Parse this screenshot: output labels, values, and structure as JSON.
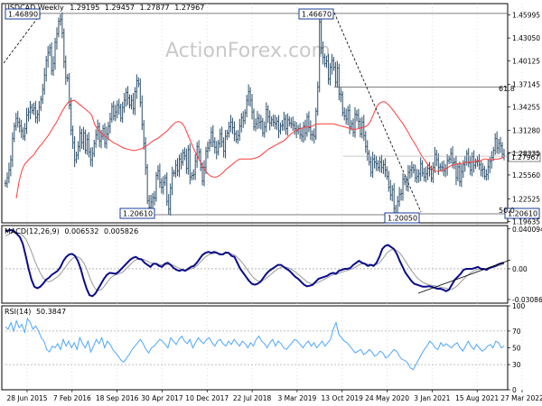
{
  "watermark": "ActionForex.com",
  "colors": {
    "price_bar": "#2a4e6c",
    "ema": "#ff3b3b",
    "macd": "#0b0b8a",
    "signal": "#9a9a9a",
    "rsi": "#4da6ff",
    "grid": "#c8c8c8",
    "frame": "#000000",
    "box": "#1a3c9c"
  },
  "chart_data": [
    {
      "type": "candlestick",
      "title": "USDCAD,Weekly",
      "ohlc_header": [
        "1.29195",
        "1.29457",
        "1.27877",
        "1.27967"
      ],
      "y_ticks": [
        "1.45995",
        "1.43050",
        "1.40125",
        "1.37145",
        "1.34255",
        "1.31280",
        "1.28335",
        "1.25560",
        "1.22525",
        "1.19635"
      ],
      "last_price": "1.27967",
      "ylim": [
        1.1945,
        1.4744
      ],
      "x_ticks": [
        "28 Jun 2015",
        "7 Feb 2016",
        "18 Sep 2016",
        "30 Apr 2017",
        "10 Dec 2017",
        "22 Jul 2018",
        "3 Mar 2019",
        "13 Oct 2019",
        "24 May 2020",
        "3 Jan 2021",
        "15 Aug 2021",
        "27 Mar 2022"
      ],
      "close_series": [
        1.245,
        1.252,
        1.262,
        1.275,
        1.302,
        1.318,
        1.328,
        1.323,
        1.318,
        1.312,
        1.305,
        1.315,
        1.332,
        1.336,
        1.342,
        1.338,
        1.341,
        1.329,
        1.333,
        1.342,
        1.352,
        1.365,
        1.383,
        1.402,
        1.412,
        1.418,
        1.389,
        1.398,
        1.425,
        1.436,
        1.452,
        1.454,
        1.437,
        1.4,
        1.38,
        1.379,
        1.345,
        1.313,
        1.297,
        1.275,
        1.281,
        1.292,
        1.309,
        1.297,
        1.309,
        1.287,
        1.301,
        1.285,
        1.275,
        1.283,
        1.296,
        1.307,
        1.317,
        1.299,
        1.305,
        1.315,
        1.296,
        1.308,
        1.318,
        1.327,
        1.343,
        1.331,
        1.336,
        1.345,
        1.342,
        1.328,
        1.342,
        1.351,
        1.361,
        1.354,
        1.345,
        1.351,
        1.34,
        1.362,
        1.376,
        1.372,
        1.348,
        1.32,
        1.296,
        1.265,
        1.223,
        1.214,
        1.221,
        1.227,
        1.226,
        1.255,
        1.261,
        1.246,
        1.24,
        1.246,
        1.252,
        1.222,
        1.212,
        1.239,
        1.258,
        1.258,
        1.268,
        1.261,
        1.276,
        1.272,
        1.284,
        1.28,
        1.264,
        1.288,
        1.253,
        1.255,
        1.256,
        1.273,
        1.292,
        1.285,
        1.265,
        1.248,
        1.265,
        1.286,
        1.29,
        1.297,
        1.31,
        1.298,
        1.291,
        1.285,
        1.296,
        1.308,
        1.298,
        1.286,
        1.305,
        1.309,
        1.317,
        1.323,
        1.316,
        1.308,
        1.301,
        1.306,
        1.318,
        1.329,
        1.325,
        1.335,
        1.351,
        1.362,
        1.351,
        1.336,
        1.317,
        1.321,
        1.328,
        1.323,
        1.324,
        1.309,
        1.317,
        1.339,
        1.33,
        1.322,
        1.326,
        1.323,
        1.321,
        1.324,
        1.312,
        1.318,
        1.319,
        1.327,
        1.315,
        1.326,
        1.322,
        1.321,
        1.319,
        1.315,
        1.312,
        1.315,
        1.307,
        1.305,
        1.318,
        1.309,
        1.33,
        1.316,
        1.307,
        1.307,
        1.305,
        1.337,
        1.368,
        1.451,
        1.418,
        1.406,
        1.398,
        1.401,
        1.378,
        1.393,
        1.402,
        1.393,
        1.374,
        1.392,
        1.359,
        1.358,
        1.335,
        1.331,
        1.327,
        1.338,
        1.317,
        1.321,
        1.31,
        1.333,
        1.332,
        1.324,
        1.308,
        1.323,
        1.306,
        1.292,
        1.283,
        1.272,
        1.259,
        1.276,
        1.272,
        1.27,
        1.265,
        1.272,
        1.265,
        1.269,
        1.262,
        1.254,
        1.24,
        1.23,
        1.237,
        1.213,
        1.203,
        1.222,
        1.231,
        1.232,
        1.25,
        1.247,
        1.241,
        1.259,
        1.262,
        1.265,
        1.262,
        1.252,
        1.254,
        1.257,
        1.27,
        1.258,
        1.253,
        1.257,
        1.264,
        1.263,
        1.251,
        1.265,
        1.282,
        1.275,
        1.265,
        1.266,
        1.265,
        1.261,
        1.264,
        1.274,
        1.276,
        1.283,
        1.271,
        1.272,
        1.252,
        1.266,
        1.247,
        1.26,
        1.269,
        1.272,
        1.283,
        1.271,
        1.262,
        1.279,
        1.268,
        1.272,
        1.273,
        1.269,
        1.262,
        1.263,
        1.254,
        1.256,
        1.266,
        1.273,
        1.278,
        1.287,
        1.302,
        1.29,
        1.296,
        1.293,
        1.282,
        1.28
      ],
      "ema_series": [
        1.226,
        1.248,
        1.262,
        1.27,
        1.274,
        1.278,
        1.281,
        1.287,
        1.292,
        1.296,
        1.301,
        1.306,
        1.312,
        1.318,
        1.324,
        1.331,
        1.338,
        1.344,
        1.349,
        1.35,
        1.351,
        1.348,
        1.345,
        1.342,
        1.339,
        1.336,
        1.332,
        1.32,
        1.314,
        1.31,
        1.307,
        1.304,
        1.301,
        1.298,
        1.296,
        1.294,
        1.292,
        1.29,
        1.289,
        1.288,
        1.287,
        1.287,
        1.288,
        1.289,
        1.291,
        1.293,
        1.296,
        1.299,
        1.301,
        1.303,
        1.306,
        1.309,
        1.312,
        1.316,
        1.32,
        1.323,
        1.324,
        1.322,
        1.317,
        1.308,
        1.299,
        1.29,
        1.282,
        1.275,
        1.268,
        1.262,
        1.257,
        1.254,
        1.253,
        1.253,
        1.255,
        1.258,
        1.262,
        1.265,
        1.268,
        1.271,
        1.274,
        1.276,
        1.276,
        1.276,
        1.276,
        1.276,
        1.277,
        1.278,
        1.28,
        1.283,
        1.286,
        1.289,
        1.291,
        1.293,
        1.295,
        1.297,
        1.299,
        1.302,
        1.306,
        1.309,
        1.312,
        1.314,
        1.315,
        1.316,
        1.317,
        1.317,
        1.318,
        1.32,
        1.321,
        1.321,
        1.321,
        1.321,
        1.321,
        1.321,
        1.32,
        1.319,
        1.318,
        1.317,
        1.316,
        1.315,
        1.314,
        1.314,
        1.315,
        1.316,
        1.317,
        1.319,
        1.324,
        1.333,
        1.342,
        1.347,
        1.349,
        1.349,
        1.346,
        1.342,
        1.337,
        1.332,
        1.327,
        1.322,
        1.316,
        1.31,
        1.303,
        1.297,
        1.291,
        1.284,
        1.278,
        1.273,
        1.268,
        1.264,
        1.261,
        1.26,
        1.261,
        1.262,
        1.264,
        1.266,
        1.268,
        1.269,
        1.27,
        1.27,
        1.271,
        1.272,
        1.272,
        1.272,
        1.273,
        1.274,
        1.274,
        1.276,
        1.276,
        1.275,
        1.275,
        1.276,
        1.276,
        1.277,
        1.278
      ]
    },
    {
      "type": "line",
      "title": "MACD(12,26,9)",
      "values_header": [
        "0.006532",
        "0.005826"
      ],
      "y_ticks": [
        "0.040094",
        "0.00",
        "-0.03086"
      ],
      "ylim": [
        -0.0345,
        0.0435
      ],
      "series": [
        {
          "values": [
            0.038,
            0.0385,
            0.039,
            0.0378,
            0.035,
            0.032,
            0.025,
            0.013,
            0.0,
            -0.011,
            -0.018,
            -0.0195,
            -0.018,
            -0.015,
            -0.011,
            -0.009,
            -0.006,
            -0.004,
            -0.002,
            0.002,
            0.008,
            0.012,
            0.0145,
            0.015,
            0.013,
            0.008,
            0.0,
            -0.011,
            -0.02,
            -0.0265,
            -0.0275,
            -0.025,
            -0.02,
            -0.015,
            -0.01,
            -0.006,
            -0.004,
            -0.0045,
            -0.005,
            -0.003,
            0.0,
            0.003,
            0.006,
            0.009,
            0.011,
            0.012,
            0.01,
            0.0095,
            0.006,
            0.004,
            0.002,
            0.005,
            0.005,
            0.003,
            0.002,
            0.005,
            0.006,
            0.004,
            0.001,
            -0.001,
            -0.002,
            -0.001,
            -0.002,
            0.0,
            0.002,
            0.003,
            0.006,
            0.01,
            0.014,
            0.016,
            0.017,
            0.016,
            0.017,
            0.016,
            0.0145,
            0.0145,
            0.0165,
            0.016,
            0.013,
            0.012,
            0.006,
            0.0,
            -0.004,
            -0.008,
            -0.012,
            -0.015,
            -0.016,
            -0.015,
            -0.013,
            -0.009,
            -0.005,
            -0.002,
            0.0,
            0.002,
            0.004,
            0.004,
            0.002,
            0.0,
            -0.002,
            -0.005,
            -0.008,
            -0.01,
            -0.013,
            -0.016,
            -0.0175,
            -0.017,
            -0.016,
            -0.013,
            -0.01,
            -0.009,
            -0.008,
            -0.007,
            -0.005,
            -0.004,
            -0.005,
            -0.002,
            -0.001,
            0.0,
            0.0,
            0.001,
            0.004,
            0.006,
            0.008,
            0.006,
            0.005,
            0.003,
            0.004,
            0.003,
            0.006,
            0.012,
            0.02,
            0.023,
            0.024,
            0.022,
            0.02,
            0.015,
            0.008,
            0.002,
            -0.004,
            -0.008,
            -0.012,
            -0.015,
            -0.016,
            -0.017,
            -0.018,
            -0.018,
            -0.0175,
            -0.018,
            -0.019,
            -0.02,
            -0.02,
            -0.021,
            -0.0225,
            -0.021,
            -0.016,
            -0.011,
            -0.008,
            -0.005,
            -0.001,
            0.0,
            0.0,
            0.0,
            0.001,
            0.002,
            0.0,
            0.0,
            -0.001,
            0.001,
            0.002,
            0.003,
            0.0045,
            0.0055,
            0.006
          ]
        },
        {
          "values": [
            0.033,
            0.0345,
            0.036,
            0.0368,
            0.0365,
            0.0355,
            0.0335,
            0.03,
            0.024,
            0.017,
            0.009,
            0.002,
            -0.004,
            -0.009,
            -0.012,
            -0.013,
            -0.012,
            -0.01,
            -0.008,
            -0.005,
            -0.001,
            0.003,
            0.007,
            0.01,
            0.012,
            0.012,
            0.01,
            0.006,
            0.0,
            -0.008,
            -0.015,
            -0.02,
            -0.022,
            -0.021,
            -0.018,
            -0.014,
            -0.01,
            -0.0075,
            -0.006,
            -0.005,
            -0.004,
            -0.002,
            0.001,
            0.004,
            0.007,
            0.009,
            0.01,
            0.01,
            0.009,
            0.0075,
            0.006,
            0.005,
            0.005,
            0.0045,
            0.004,
            0.004,
            0.0045,
            0.0045,
            0.0035,
            0.002,
            0.0005,
            -0.0005,
            -0.001,
            -0.001,
            0.0,
            0.001,
            0.003,
            0.006,
            0.009,
            0.012,
            0.014,
            0.015,
            0.0155,
            0.0158,
            0.0155,
            0.0152,
            0.0155,
            0.0156,
            0.015,
            0.014,
            0.0115,
            0.0085,
            0.005,
            0.001,
            -0.003,
            -0.007,
            -0.01,
            -0.012,
            -0.0125,
            -0.0115,
            -0.0095,
            -0.007,
            -0.0045,
            -0.002,
            0.0,
            0.0015,
            0.002,
            0.0015,
            0.0005,
            -0.001,
            -0.003,
            -0.0055,
            -0.008,
            -0.0105,
            -0.013,
            -0.0145,
            -0.015,
            -0.0145,
            -0.0135,
            -0.012,
            -0.0105,
            -0.009,
            -0.0075,
            -0.006,
            -0.0055,
            -0.0045,
            -0.0035,
            -0.0025,
            -0.0015,
            -0.0008,
            0.0005,
            0.002,
            0.004,
            0.005,
            0.0052,
            0.0048,
            0.0045,
            0.004,
            0.0043,
            0.006,
            0.0095,
            0.0135,
            0.017,
            0.019,
            0.0195,
            0.0185,
            0.016,
            0.012,
            0.0075,
            0.003,
            -0.0015,
            -0.0055,
            -0.009,
            -0.0115,
            -0.0135,
            -0.015,
            -0.016,
            -0.0165,
            -0.017,
            -0.0178,
            -0.0185,
            -0.019,
            -0.0195,
            -0.0205,
            -0.0205,
            -0.019,
            -0.0165,
            -0.0135,
            -0.0105,
            -0.0075,
            -0.005,
            -0.003,
            -0.0015,
            -0.0005,
            0.0,
            0.0,
            0.0,
            0.0005,
            0.0012,
            0.002,
            0.003,
            0.004,
            0.005
          ]
        }
      ]
    },
    {
      "type": "line",
      "title": "RSI(14)",
      "values_header": [
        "50.3847"
      ],
      "y_ticks": [
        "100",
        "70",
        "50",
        "30",
        "0"
      ],
      "ylim": [
        0,
        100
      ],
      "series": [
        {
          "values": [
            75,
            72,
            80,
            70,
            82,
            74,
            78,
            68,
            85,
            80,
            72,
            76,
            70,
            62,
            58,
            48,
            45,
            52,
            50,
            55,
            48,
            60,
            52,
            58,
            50,
            56,
            48,
            62,
            55,
            50,
            58,
            45,
            52,
            60,
            55,
            62,
            50,
            58,
            54,
            48,
            44,
            40,
            35,
            33,
            38,
            42,
            48,
            52,
            56,
            60,
            55,
            48,
            44,
            50,
            52,
            56,
            60,
            58,
            54,
            50,
            62,
            58,
            54,
            60,
            64,
            58,
            55,
            60,
            50,
            56,
            62,
            58,
            55,
            60,
            62,
            56,
            52,
            58,
            60,
            55,
            52,
            58,
            54,
            60,
            56,
            52,
            58,
            55,
            50,
            56,
            52,
            60,
            64,
            58,
            55,
            50,
            56,
            60,
            52,
            58,
            55,
            50,
            48,
            52,
            56,
            60,
            58,
            54,
            50,
            55,
            58,
            52,
            56,
            50,
            54,
            58,
            52,
            56,
            60,
            72,
            80,
            66,
            62,
            58,
            56,
            52,
            48,
            44,
            46,
            48,
            42,
            44,
            48,
            45,
            40,
            42,
            46,
            44,
            38,
            40,
            44,
            48,
            46,
            40,
            36,
            35,
            32,
            26,
            24,
            30,
            36,
            42,
            48,
            52,
            58,
            55,
            50,
            48,
            56,
            52,
            55,
            52,
            50,
            54,
            56,
            50,
            46,
            52,
            58,
            52,
            48,
            54,
            50,
            46,
            48,
            52,
            54,
            50,
            58,
            56,
            50,
            52
          ]
        }
      ]
    }
  ],
  "annotations": {
    "box_high_left": "1.46890",
    "box_high_mid": "1.46670",
    "box_low_left": "1.20610",
    "box_low_mid": "1.20050",
    "box_low_right": "1.20610",
    "fib_618": "61.8",
    "fib_50": "50.0"
  }
}
